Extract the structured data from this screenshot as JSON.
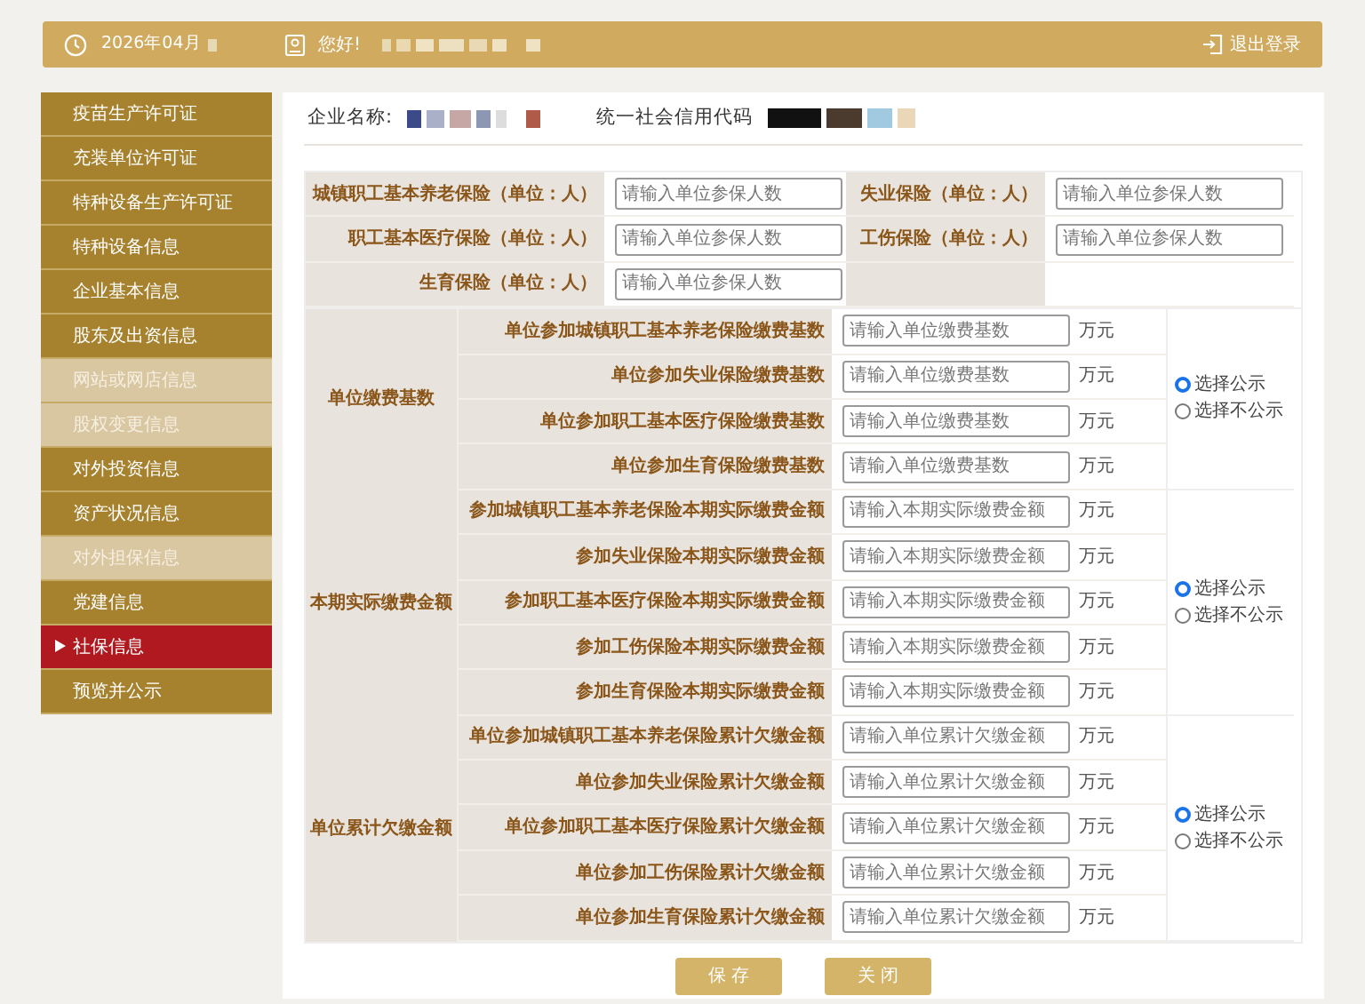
{
  "header": {
    "date": "2026年04月",
    "greeting": "您好!",
    "logout": "退出登录"
  },
  "sidebar": {
    "items": [
      {
        "label": "疫苗生产许可证",
        "selected": false,
        "disabled": false
      },
      {
        "label": "充装单位许可证",
        "selected": false,
        "disabled": false
      },
      {
        "label": "特种设备生产许可证",
        "selected": false,
        "disabled": false
      },
      {
        "label": "特种设备信息",
        "selected": false,
        "disabled": false
      },
      {
        "label": "企业基本信息",
        "selected": false,
        "disabled": false
      },
      {
        "label": "股东及出资信息",
        "selected": false,
        "disabled": false
      },
      {
        "label": "网站或网店信息",
        "selected": false,
        "disabled": true
      },
      {
        "label": "股权变更信息",
        "selected": false,
        "disabled": true
      },
      {
        "label": "对外投资信息",
        "selected": false,
        "disabled": false
      },
      {
        "label": "资产状况信息",
        "selected": false,
        "disabled": false
      },
      {
        "label": "对外担保信息",
        "selected": false,
        "disabled": true
      },
      {
        "label": "党建信息",
        "selected": false,
        "disabled": false
      },
      {
        "label": "社保信息",
        "selected": true,
        "disabled": false
      },
      {
        "label": "预览并公示",
        "selected": false,
        "disabled": false
      }
    ]
  },
  "company": {
    "name_label": "企业名称:",
    "code_label": "统一社会信用代码"
  },
  "insured_counts": [
    {
      "label": "城镇职工基本养老保险（单位：人）",
      "placeholder": "请输入单位参保人数"
    },
    {
      "label": "失业保险（单位：人）",
      "placeholder": "请输入单位参保人数"
    },
    {
      "label": "职工基本医疗保险（单位：人）",
      "placeholder": "请输入单位参保人数"
    },
    {
      "label": "工伤保险（单位：人）",
      "placeholder": "请输入单位参保人数"
    },
    {
      "label": "生育保险（单位：人）",
      "placeholder": "请输入单位参保人数"
    }
  ],
  "groups": [
    {
      "label": "单位缴费基数",
      "rows": [
        {
          "label": "单位参加城镇职工基本养老保险缴费基数",
          "placeholder": "请输入单位缴费基数",
          "unit": "万元"
        },
        {
          "label": "单位参加失业保险缴费基数",
          "placeholder": "请输入单位缴费基数",
          "unit": "万元"
        },
        {
          "label": "单位参加职工基本医疗保险缴费基数",
          "placeholder": "请输入单位缴费基数",
          "unit": "万元"
        },
        {
          "label": "单位参加生育保险缴费基数",
          "placeholder": "请输入单位缴费基数",
          "unit": "万元"
        }
      ],
      "options": [
        {
          "label": "选择公示",
          "selected": true
        },
        {
          "label": "选择不公示",
          "selected": false
        }
      ]
    },
    {
      "label": "本期实际缴费金额",
      "rows": [
        {
          "label": "参加城镇职工基本养老保险本期实际缴费金额",
          "placeholder": "请输入本期实际缴费金额",
          "unit": "万元"
        },
        {
          "label": "参加失业保险本期实际缴费金额",
          "placeholder": "请输入本期实际缴费金额",
          "unit": "万元"
        },
        {
          "label": "参加职工基本医疗保险本期实际缴费金额",
          "placeholder": "请输入本期实际缴费金额",
          "unit": "万元"
        },
        {
          "label": "参加工伤保险本期实际缴费金额",
          "placeholder": "请输入本期实际缴费金额",
          "unit": "万元"
        },
        {
          "label": "参加生育保险本期实际缴费金额",
          "placeholder": "请输入本期实际缴费金额",
          "unit": "万元"
        }
      ],
      "options": [
        {
          "label": "选择公示",
          "selected": true
        },
        {
          "label": "选择不公示",
          "selected": false
        }
      ]
    },
    {
      "label": "单位累计欠缴金额",
      "rows": [
        {
          "label": "单位参加城镇职工基本养老保险累计欠缴金额",
          "placeholder": "请输入单位累计欠缴金额",
          "unit": "万元"
        },
        {
          "label": "单位参加失业保险累计欠缴金额",
          "placeholder": "请输入单位累计欠缴金额",
          "unit": "万元"
        },
        {
          "label": "单位参加职工基本医疗保险累计欠缴金额",
          "placeholder": "请输入单位累计欠缴金额",
          "unit": "万元"
        },
        {
          "label": "单位参加工伤保险累计欠缴金额",
          "placeholder": "请输入单位累计欠缴金额",
          "unit": "万元"
        },
        {
          "label": "单位参加生育保险累计欠缴金额",
          "placeholder": "请输入单位累计欠缴金额",
          "unit": "万元"
        }
      ],
      "options": [
        {
          "label": "选择公示",
          "selected": true
        },
        {
          "label": "选择不公示",
          "selected": false
        }
      ]
    }
  ],
  "buttons": [
    "保 存",
    "关 闭"
  ]
}
